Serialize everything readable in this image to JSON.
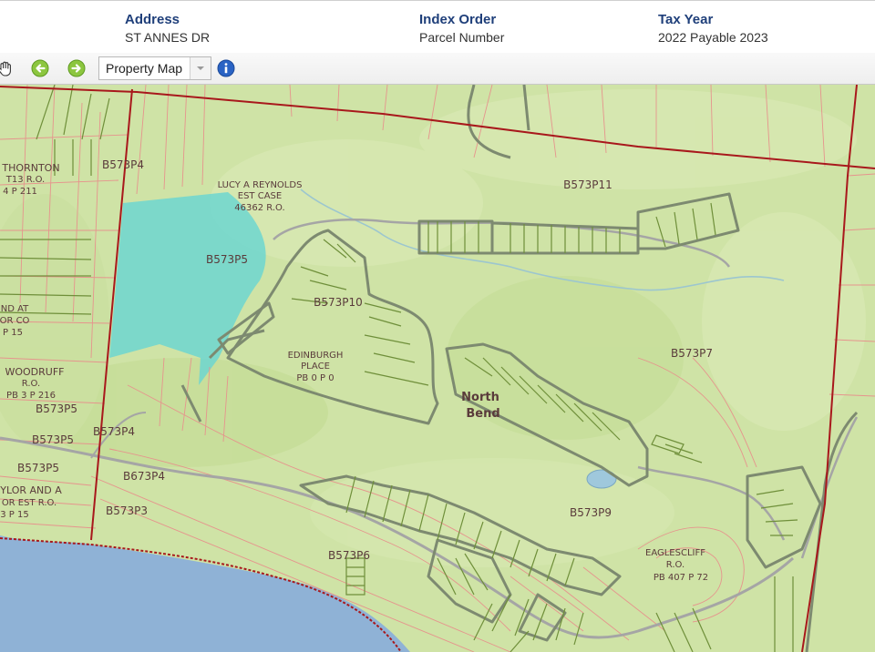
{
  "info": {
    "address_label": "Address",
    "address_value": "ST ANNES DR",
    "index_label": "Index Order",
    "index_value": "Parcel Number",
    "tax_label": "Tax Year",
    "tax_value": "2022 Payable 2023"
  },
  "toolbar": {
    "map_select_value": "Property Map",
    "icons": [
      "hand-pan-icon",
      "back-arrow-icon",
      "forward-arrow-icon",
      "info-icon"
    ]
  },
  "colors": {
    "terrain": "#cfe3a6",
    "terrain_light": "#dcebb8",
    "water": "#8fb2d6",
    "highlight_parcel": "#6dd6d0",
    "parcel_line": "#e6948d",
    "plat_line": "#6f8f3a",
    "boundary": "#a8181c",
    "road": "#9a9a9a"
  },
  "map_labels": {
    "b573p4_top": "B573P4",
    "b573p11": "B573P11",
    "lucy_1": "LUCY A REYNOLDS",
    "lucy_2": "EST CASE",
    "lucy_3": "46362 R.O.",
    "b573p5_main": "B573P5",
    "b573p10": "B573P10",
    "edinburgh_1": "EDINBURGH",
    "edinburgh_2": "PLACE",
    "edinburgh_3": "PB 0 P 0",
    "north": "North",
    "bend": "Bend",
    "b573p7": "B573P7",
    "thornton_1": "THORNTON",
    "thornton_2": "T13 R.O.",
    "thornton_3": "4 P 211",
    "nd_at": "ND AT",
    "or_co": "OR CO",
    "p15_a": "P 15",
    "woodruff_1": "WOODRUFF",
    "woodruff_2": "R.O.",
    "woodruff_3": "PB 3 P 216",
    "b573p5_a": "B573P5",
    "b573p4_b": "B573P4",
    "b573p5_b": "B573P5",
    "b573p5_c": "B573P5",
    "b673p4": "B673P4",
    "taylor_1": "YLOR AND A",
    "taylor_2": "OR EST R.O.",
    "taylor_3": "3 P 15",
    "b573p3": "B573P3",
    "b573p9": "B573P9",
    "b573p6": "B573P6",
    "eaglescliff_1": "EAGLESCLIFF",
    "eaglescliff_2": "R.O.",
    "eaglescliff_3": "PB 407 P 72"
  }
}
